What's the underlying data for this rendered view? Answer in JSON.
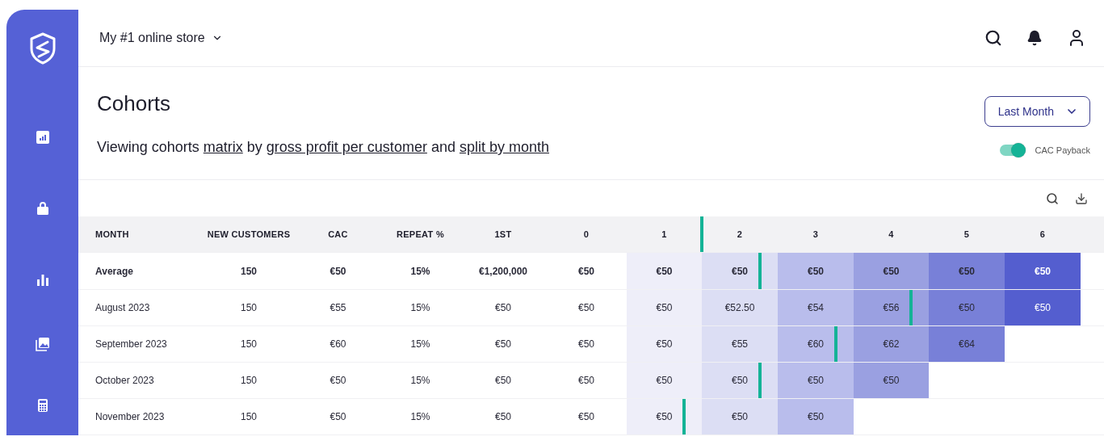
{
  "store_selector": {
    "label": "My #1 online store"
  },
  "title": "Cohorts",
  "description": {
    "prefix": "Viewing cohorts",
    "view": "matrix",
    "by": "by",
    "metric": "gross profit per customer",
    "and": "and",
    "split": "split by month"
  },
  "period_select": {
    "label": "Last Month"
  },
  "cac_payback": {
    "label": "CAC Payback",
    "on": true
  },
  "table": {
    "columns": [
      {
        "label": "MONTH"
      },
      {
        "label": "NEW CUSTOMERS"
      },
      {
        "label": "CAC"
      },
      {
        "label": "REPEAT %"
      },
      {
        "label": "1ST"
      },
      {
        "label": "0"
      }
    ],
    "periods": [
      {
        "label": "1",
        "color": "#eeeef9",
        "payback": true
      },
      {
        "label": "2",
        "color": "#dcdef4",
        "payback": false
      },
      {
        "label": "3",
        "color": "#b9bdec",
        "payback": false
      },
      {
        "label": "4",
        "color": "#9aa0e1",
        "payback": false
      },
      {
        "label": "5",
        "color": "#7880d8",
        "payback": false
      },
      {
        "label": "6",
        "color": "#545ecf",
        "payback": false
      }
    ],
    "rows": [
      {
        "kind": "average",
        "month": "Average",
        "new_customers": "150",
        "cac": "€50",
        "repeat": "15%",
        "first": "€1,200,000",
        "p0": "€50",
        "periods": [
          {
            "value": "€50",
            "payback": false
          },
          {
            "value": "€50",
            "payback": true
          },
          {
            "value": "€50",
            "payback": false
          },
          {
            "value": "€50",
            "payback": false
          },
          {
            "value": "€50",
            "payback": false
          },
          {
            "value": "€50",
            "payback": false
          }
        ]
      },
      {
        "kind": "cohort",
        "month": "August 2023",
        "new_customers": "150",
        "cac": "€55",
        "repeat": "15%",
        "first": "€50",
        "p0": "€50",
        "periods": [
          {
            "value": "€50",
            "payback": false
          },
          {
            "value": "€52.50",
            "payback": false
          },
          {
            "value": "€54",
            "payback": false
          },
          {
            "value": "€56",
            "payback": true
          },
          {
            "value": "€50",
            "payback": false
          },
          {
            "value": "€50",
            "payback": false
          }
        ]
      },
      {
        "kind": "cohort",
        "month": "September 2023",
        "new_customers": "150",
        "cac": "€60",
        "repeat": "15%",
        "first": "€50",
        "p0": "€50",
        "periods": [
          {
            "value": "€50",
            "payback": false
          },
          {
            "value": "€55",
            "payback": false
          },
          {
            "value": "€60",
            "payback": true
          },
          {
            "value": "€62",
            "payback": false
          },
          {
            "value": "€64",
            "payback": false
          }
        ]
      },
      {
        "kind": "cohort",
        "month": "October 2023",
        "new_customers": "150",
        "cac": "€50",
        "repeat": "15%",
        "first": "€50",
        "p0": "€50",
        "periods": [
          {
            "value": "€50",
            "payback": false
          },
          {
            "value": "€50",
            "payback": true
          },
          {
            "value": "€50",
            "payback": false
          },
          {
            "value": "€50",
            "payback": false
          }
        ]
      },
      {
        "kind": "cohort",
        "month": "November 2023",
        "new_customers": "150",
        "cac": "€50",
        "repeat": "15%",
        "first": "€50",
        "p0": "€50",
        "periods": [
          {
            "value": "€50",
            "payback": true
          },
          {
            "value": "€50",
            "payback": false
          },
          {
            "value": "€50",
            "payback": false
          }
        ]
      }
    ]
  }
}
